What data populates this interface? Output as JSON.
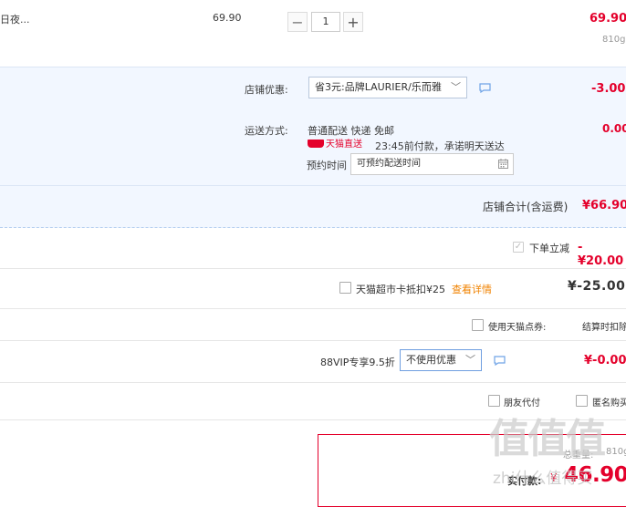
{
  "product": {
    "name_fragment": "日夜...",
    "unit_price": "69.90",
    "quantity": "1",
    "minus": "−",
    "plus": "+",
    "subtotal": "69.90",
    "weight": "810g"
  },
  "shop": {
    "discount_label": "店铺优惠:",
    "discount_select": "省3元:品牌LAURIER/乐而雅",
    "discount_amount": "-3.00",
    "shipping_label": "运送方式:",
    "shipping_method": "普通配送 快递 免邮",
    "tmall_tag": "天猫直送",
    "delivery_promise": "23:45前付款，承诺明天送达",
    "shipping_amount": "0.00",
    "appointment_label": "预约时间",
    "appointment_placeholder": "可预约配送时间",
    "total_label": "店铺合计(含运费)",
    "total_amount": "¥66.90"
  },
  "order_discount": {
    "label": "下单立减",
    "amount": "-¥20.00"
  },
  "supermarket_card": {
    "label": "天猫超市卡抵扣¥25",
    "link": "查看详情",
    "amount": "¥-25.00"
  },
  "points": {
    "label": "使用天猫点券:",
    "note": "结算时扣除"
  },
  "vip": {
    "label": "88VIP专享9.5折",
    "select": "不使用优惠",
    "amount": "¥-0.00"
  },
  "options": {
    "friend_pay": "朋友代付",
    "anonymous": "匿名购买"
  },
  "summary": {
    "weight_label": "总重量:",
    "weight": "810g",
    "pay_label": "实付款:",
    "currency": "¥",
    "pay_amount": "46.90"
  },
  "watermark": {
    "logo": "值值值",
    "text": "zhi什么值得买"
  },
  "colors": {
    "price_red": "#e4002b",
    "link_orange": "#f08200",
    "shop_bg": "#f2f7ff",
    "select_border_active": "#6f9fe0"
  },
  "icons": {
    "chat": "chat-bubble-icon",
    "calendar": "calendar-icon",
    "check": "checkmark-icon",
    "chevron": "chevron-down-icon"
  }
}
